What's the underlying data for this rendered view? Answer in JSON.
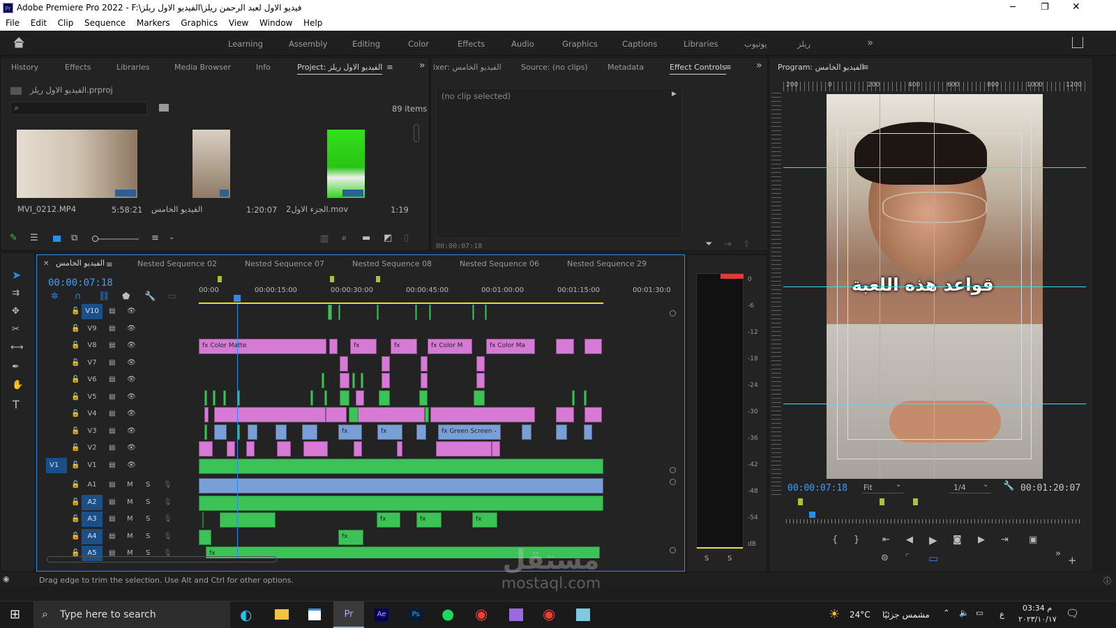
{
  "window": {
    "title": "Adobe Premiere Pro 2022 - F:\\فيديو الاول لعبد الرحمن ريلز\\الفيديو الاول ريلز",
    "app_badge": "Pr",
    "min": "─",
    "max": "❐",
    "close": "✕"
  },
  "menu": [
    "File",
    "Edit",
    "Clip",
    "Sequence",
    "Markers",
    "Graphics",
    "View",
    "Window",
    "Help"
  ],
  "workspaces": [
    "Learning",
    "Assembly",
    "Editing",
    "Color",
    "Effects",
    "Audio",
    "Graphics",
    "Captions",
    "Libraries",
    "يوتيوب",
    "ريلز"
  ],
  "project_panel": {
    "tabs": [
      "History",
      "Effects",
      "Libraries",
      "Media Browser",
      "Info",
      "Project: الفيديو الاول ريلز"
    ],
    "file": "الفيديو الاول ريلز.prproj",
    "items_count": "89 items",
    "items": [
      {
        "name": "MVI_0212.MP4",
        "duration": "5:58:21"
      },
      {
        "name": "الفيديو الخامس",
        "duration": "1:20:07"
      },
      {
        "name": "الجزء الاول2.mov",
        "duration": "1:19"
      }
    ]
  },
  "effect_panel": {
    "tabs": [
      "ixer: الفيديو الخامس",
      "Source: (no clips)",
      "Metadata",
      "Effect Controls"
    ],
    "no_clip": "(no clip selected)",
    "timecode": "00:00:07:18"
  },
  "program": {
    "title": "Program: الفيديو الخامس",
    "caption": "قواعد هذه اللعبة",
    "timecode": "00:00:07:18",
    "fit": "Fit",
    "quality": "1/4",
    "duration": "00:01:20:07",
    "ruler": [
      "200",
      "0",
      "200",
      "400",
      "600",
      "800",
      "1000",
      "1200"
    ]
  },
  "timeline": {
    "tabs": [
      "الفيديو الخامس",
      "Nested Sequence 02",
      "Nested Sequence 07",
      "Nested Sequence 08",
      "Nested Sequence 06",
      "Nested Sequence 29"
    ],
    "timecode": "00:00:07:18",
    "ruler": [
      "00:00",
      "00:00:15:00",
      "00:00:30:00",
      "00:00:45:00",
      "00:01:00:00",
      "00:01:15:00",
      "00:01:30:0"
    ],
    "video_tracks": [
      "V10",
      "V9",
      "V8",
      "V7",
      "V6",
      "V5",
      "V4",
      "V3",
      "V2",
      "V1"
    ],
    "audio_tracks": [
      "A1",
      "A2",
      "A3",
      "A4",
      "A5"
    ],
    "source_patch": "V1",
    "m": "M",
    "s": "S",
    "clip_labels": {
      "color_matte": "Color Matte",
      "color_m": "Color M",
      "color_ma": "Color Ma",
      "green_screen": "Green Screen -",
      "fx": "fx"
    }
  },
  "meter": {
    "scale": [
      "0",
      "-6",
      "-12",
      "-18",
      "-24",
      "-30",
      "-36",
      "-42",
      "-48",
      "-54",
      "dB"
    ],
    "solo": "S"
  },
  "status": {
    "hint": "Drag edge to trim the selection. Use Alt and Ctrl for other options."
  },
  "taskbar": {
    "search_placeholder": "Type here to search",
    "weather_temp": "24°C",
    "weather_text": "مشمس جزئيًا",
    "time": "03:34 م",
    "date": "٢٠٢٣/١٠/١٧",
    "lang": "ع",
    "apps": [
      "Pr",
      "Ae",
      "Ps"
    ]
  },
  "watermark": {
    "arabic": "مستقل",
    "latin": "mostaql.com"
  },
  "colors": {
    "accent": "#2d8ceb",
    "pink": "#d77ad6",
    "green": "#3cc257",
    "blue": "#7a9fd6",
    "yellow": "#e8e020"
  }
}
